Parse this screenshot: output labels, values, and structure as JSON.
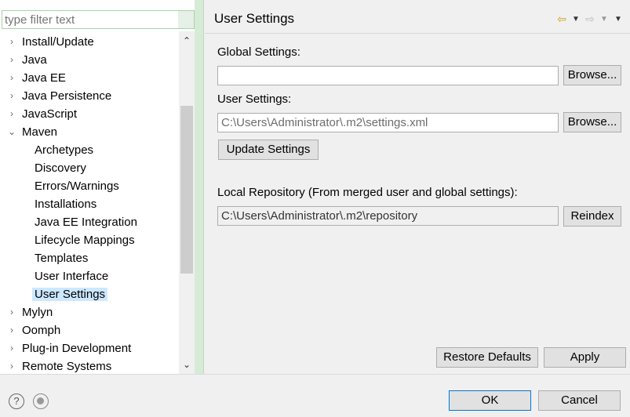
{
  "filter": {
    "placeholder": "type filter text"
  },
  "tree": {
    "items": [
      {
        "label": "Install/Update",
        "twisty": "›"
      },
      {
        "label": "Java",
        "twisty": "›"
      },
      {
        "label": "Java EE",
        "twisty": "›"
      },
      {
        "label": "Java Persistence",
        "twisty": "›"
      },
      {
        "label": "JavaScript",
        "twisty": "›"
      },
      {
        "label": "Maven",
        "twisty": "⌄"
      },
      {
        "label": "Archetypes"
      },
      {
        "label": "Discovery"
      },
      {
        "label": "Errors/Warnings"
      },
      {
        "label": "Installations"
      },
      {
        "label": "Java EE Integration"
      },
      {
        "label": "Lifecycle Mappings"
      },
      {
        "label": "Templates"
      },
      {
        "label": "User Interface"
      },
      {
        "label": "User Settings"
      },
      {
        "label": "Mylyn",
        "twisty": "›"
      },
      {
        "label": "Oomph",
        "twisty": "›"
      },
      {
        "label": "Plug-in Development",
        "twisty": "›"
      },
      {
        "label": "Remote Systems",
        "twisty": "›"
      }
    ]
  },
  "page": {
    "title": "User Settings",
    "nav": {
      "back": "⇦",
      "forward": "⇨",
      "dropdown": "▼",
      "menu": "▼"
    },
    "global_label": "Global Settings:",
    "global_value": "",
    "browse_label": "Browse...",
    "user_label": "User Settings:",
    "user_value": "C:\\Users\\Administrator\\.m2\\settings.xml",
    "update_label": "Update Settings",
    "local_label": "Local Repository (From merged user and global settings):",
    "local_value": "C:\\Users\\Administrator\\.m2\\repository",
    "reindex_label": "Reindex",
    "restore_label": "Restore Defaults",
    "apply_label": "Apply"
  },
  "footer": {
    "help": "?",
    "ok_label": "OK",
    "cancel_label": "Cancel"
  },
  "colors": {
    "accent_border": "#0078d7",
    "selection": "#cce8ff"
  }
}
